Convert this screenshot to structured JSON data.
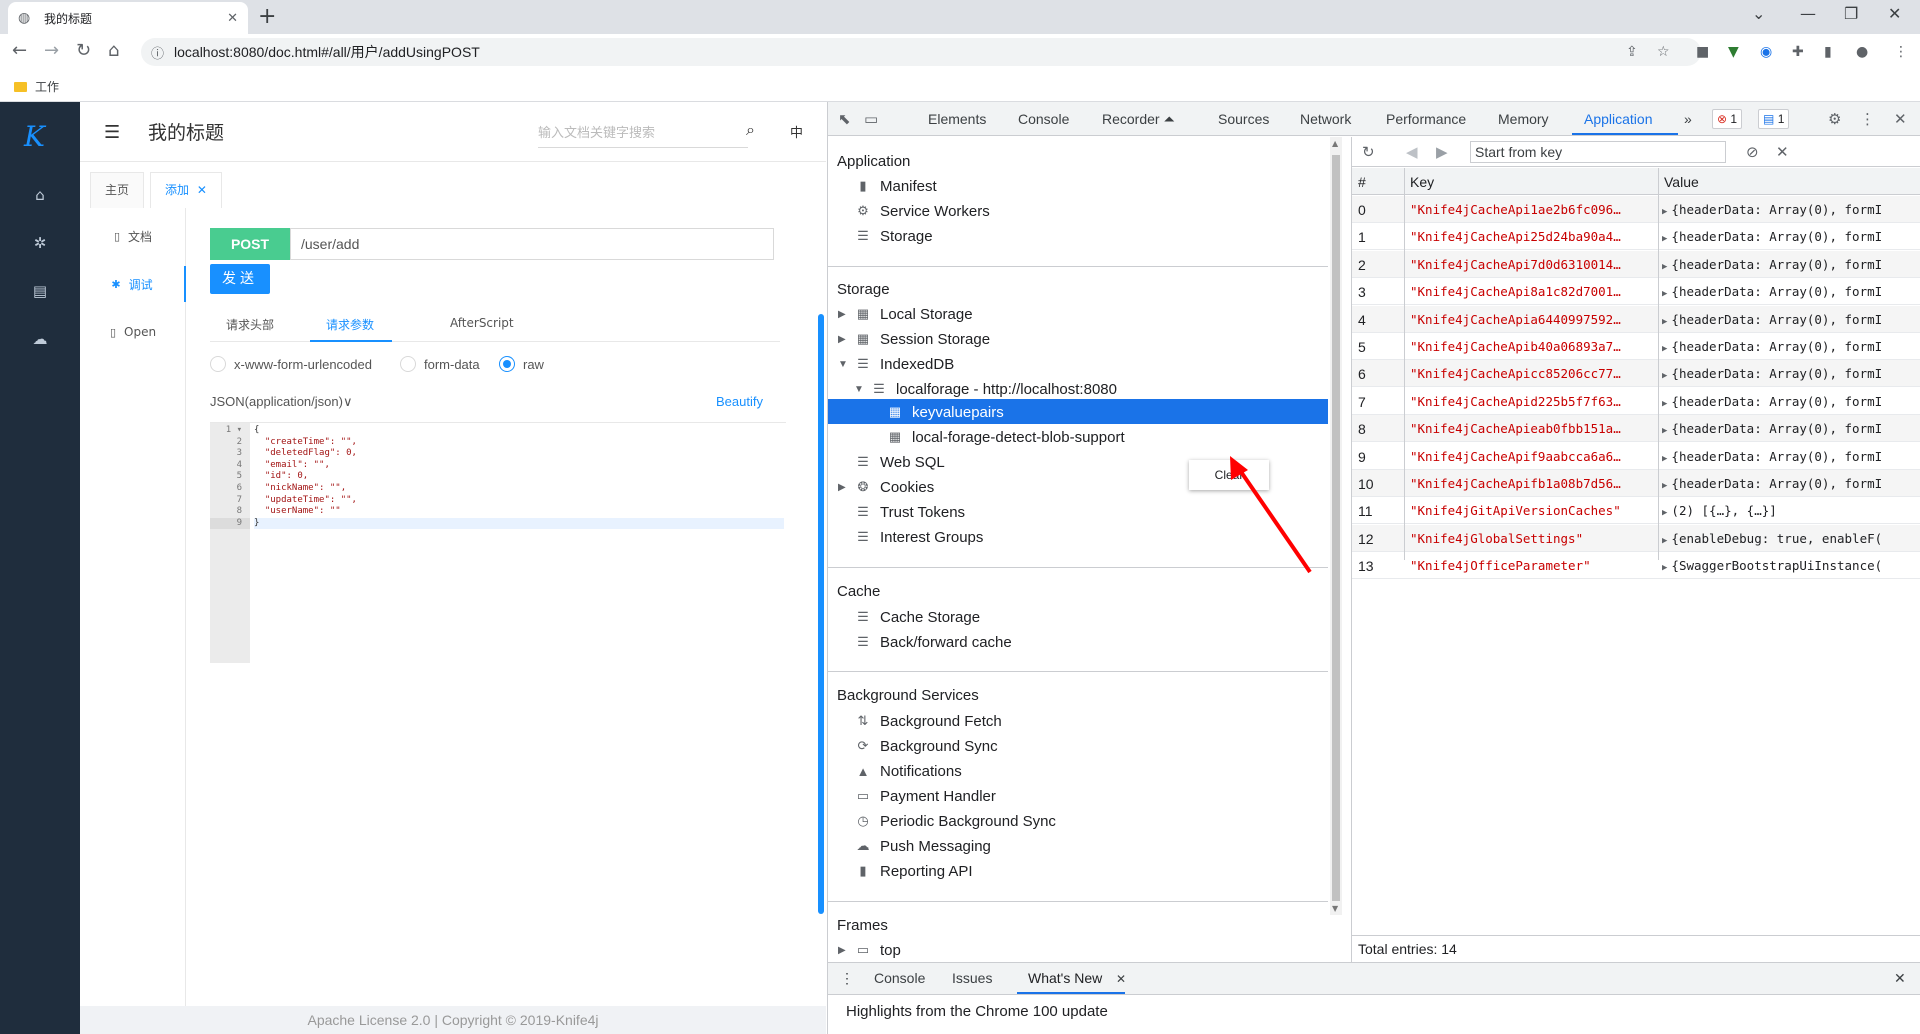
{
  "browser": {
    "tab_title": "我的标题",
    "tab_close": "✕",
    "new_tab": "+",
    "url": "localhost:8080/doc.html#/all/用户/addUsingPOST",
    "bookmark": "工作"
  },
  "knife4j": {
    "logo": "K",
    "title": "我的标题",
    "search_placeholder": "输入文档关键字搜索",
    "lang": "中",
    "tabs": [
      "主页",
      "添加"
    ],
    "tab_close": "✕",
    "side": [
      "文档",
      "调试",
      "Open"
    ],
    "method": "POST",
    "path": "/user/add",
    "send": "发送",
    "subtabs": [
      "请求头部",
      "请求参数",
      "AfterScript"
    ],
    "radios": [
      "x-www-form-urlencoded",
      "form-data",
      "raw"
    ],
    "content_type": "JSON(application/json)∨",
    "beautify": "Beautify",
    "line_numbers": [
      "1 ▾",
      "2",
      "3",
      "4",
      "5",
      "6",
      "7",
      "8",
      "9"
    ],
    "code_lines": [
      "{",
      "  \"createTime\": \"\",",
      "  \"deletedFlag\": 0,",
      "  \"email\": \"\",",
      "  \"id\": 0,",
      "  \"nickName\": \"\",",
      "  \"updateTime\": \"\",",
      "  \"userName\": \"\"",
      "}"
    ],
    "footer": "Apache License 2.0 | Copyright © 2019-Knife4j"
  },
  "devtools": {
    "tabs": [
      "Elements",
      "Console",
      "Recorder ⏶",
      "Sources",
      "Network",
      "Performance",
      "Memory",
      "Application",
      "»"
    ],
    "errors": "1",
    "messages": "1",
    "sections": {
      "application": {
        "header": "Application",
        "items": [
          "Manifest",
          "Service Workers",
          "Storage"
        ]
      },
      "storage": {
        "header": "Storage",
        "items": [
          "Local Storage",
          "Session Storage",
          "IndexedDB",
          "localforage - http://localhost:8080",
          "keyvaluepairs",
          "local-forage-detect-blob-support",
          "Web SQL",
          "Cookies",
          "Trust Tokens",
          "Interest Groups"
        ]
      },
      "cache": {
        "header": "Cache",
        "items": [
          "Cache Storage",
          "Back/forward cache"
        ]
      },
      "background": {
        "header": "Background Services",
        "items": [
          "Background Fetch",
          "Background Sync",
          "Notifications",
          "Payment Handler",
          "Periodic Background Sync",
          "Push Messaging",
          "Reporting API"
        ]
      },
      "frames": {
        "header": "Frames",
        "items": [
          "top"
        ]
      }
    },
    "context_menu": "Clear",
    "start_key_placeholder": "Start from key",
    "table_headers": [
      "#",
      "Key",
      "Value"
    ],
    "rows": [
      {
        "n": "0",
        "key": "\"Knife4jCacheApi1ae2b6fc096…",
        "value": "{headerData: Array(0), formI"
      },
      {
        "n": "1",
        "key": "\"Knife4jCacheApi25d24ba90a4…",
        "value": "{headerData: Array(0), formI"
      },
      {
        "n": "2",
        "key": "\"Knife4jCacheApi7d0d6310014…",
        "value": "{headerData: Array(0), formI"
      },
      {
        "n": "3",
        "key": "\"Knife4jCacheApi8a1c82d7001…",
        "value": "{headerData: Array(0), formI"
      },
      {
        "n": "4",
        "key": "\"Knife4jCacheApia6440997592…",
        "value": "{headerData: Array(0), formI"
      },
      {
        "n": "5",
        "key": "\"Knife4jCacheApib40a06893a7…",
        "value": "{headerData: Array(0), formI"
      },
      {
        "n": "6",
        "key": "\"Knife4jCacheApicc85206cc77…",
        "value": "{headerData: Array(0), formI"
      },
      {
        "n": "7",
        "key": "\"Knife4jCacheApid225b5f7f63…",
        "value": "{headerData: Array(0), formI"
      },
      {
        "n": "8",
        "key": "\"Knife4jCacheApieab0fbb151a…",
        "value": "{headerData: Array(0), formI"
      },
      {
        "n": "9",
        "key": "\"Knife4jCacheApif9aabcca6a6…",
        "value": "{headerData: Array(0), formI"
      },
      {
        "n": "10",
        "key": "\"Knife4jCacheApifb1a08b7d56…",
        "value": "{headerData: Array(0), formI"
      },
      {
        "n": "11",
        "key": "\"Knife4jGitApiVersionCaches\"",
        "value": "(2) [{…}, {…}]"
      },
      {
        "n": "12",
        "key": "\"Knife4jGlobalSettings\"",
        "value": "{enableDebug: true, enableF("
      },
      {
        "n": "13",
        "key": "\"Knife4jOfficeParameter\"",
        "value": "{SwaggerBootstrapUiInstance("
      }
    ],
    "total": "Total entries: 14",
    "drawer_tabs": [
      "Console",
      "Issues",
      "What's New"
    ],
    "drawer_close": "✕",
    "drawer_text": "Highlights from the Chrome 100 update"
  },
  "colors": {
    "accent": "#1890ff",
    "post_green": "#49cc90",
    "devtools_blue": "#1a73e8",
    "arrow_red": "#ff0000"
  }
}
